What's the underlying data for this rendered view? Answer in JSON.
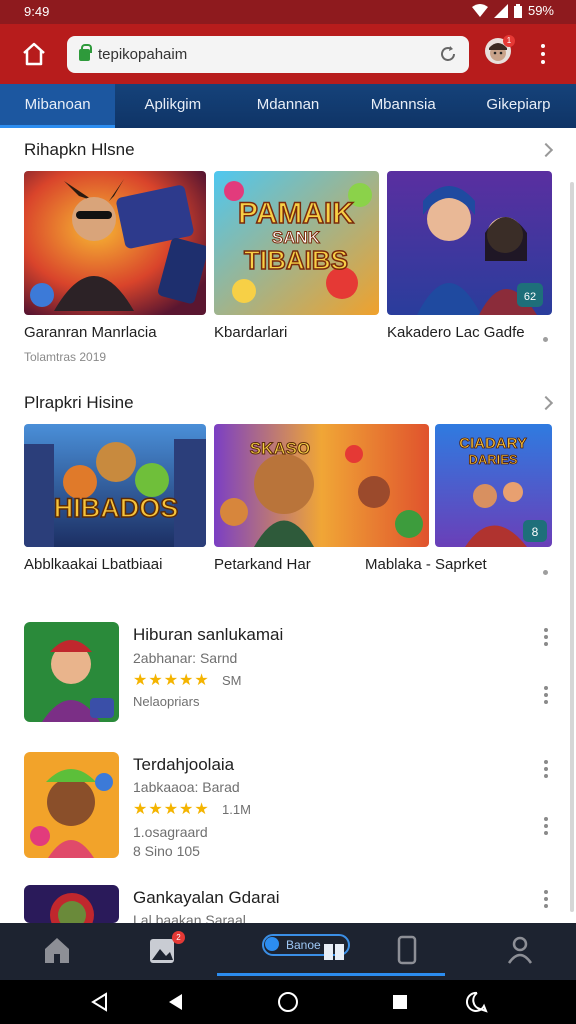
{
  "status_bar": {
    "time": "9:49",
    "battery": "59%"
  },
  "browser": {
    "url": "tepikopahaim",
    "avatar_badge": "1"
  },
  "tabs": [
    {
      "label": "Mibanoan",
      "active": true
    },
    {
      "label": "Aplikgim",
      "active": false
    },
    {
      "label": "Mdannan",
      "active": false
    },
    {
      "label": "Mbannsia",
      "active": false
    },
    {
      "label": "Gikepiarp",
      "active": false
    }
  ],
  "section1": {
    "title": "Rihapkn Hlsne",
    "cards": [
      {
        "label": "Garanran Manrlacia",
        "sub": "Tolamtras 2019"
      },
      {
        "label": "Kbardarlari",
        "art_text_1": "PAMAIK",
        "art_text_2": "SANK",
        "art_text_3": "TIBAIBS"
      },
      {
        "label": "Kakadero Lac Gadfe",
        "badge": "62"
      }
    ]
  },
  "section2": {
    "title": "Plrapkri Hisine",
    "cards": [
      {
        "label": "Abblkaakai Lbatbiaai",
        "art_text": "HIBADOS"
      },
      {
        "label": "Petarkand Har",
        "art_text": "SKASO"
      },
      {
        "label": "Mablaka - Saprket",
        "art_text_1": "CIADARY",
        "art_text_2": "DARIES",
        "badge": "8"
      }
    ]
  },
  "apps": [
    {
      "title": "Hiburan sanlukamai",
      "line1": "2abhanar: Sarnd",
      "rating": "SM",
      "line2": "Nelaopriars"
    },
    {
      "title": "Terdahjoolaia",
      "line1": "1abkaaoa: Barad",
      "rating": "1.1M",
      "line2": "1.osagraard",
      "line3": "8 Sino 105"
    },
    {
      "title": "Gankayalan Gdarai",
      "line1": "Lal baakan Saraal"
    }
  ],
  "bottom_nav": {
    "active_label": "Banoe",
    "badge": "2"
  },
  "colors": {
    "browser_red": "#b71c1c",
    "tab_blue": "#15427a",
    "accent": "#2c8df0",
    "star": "#f4b400"
  }
}
